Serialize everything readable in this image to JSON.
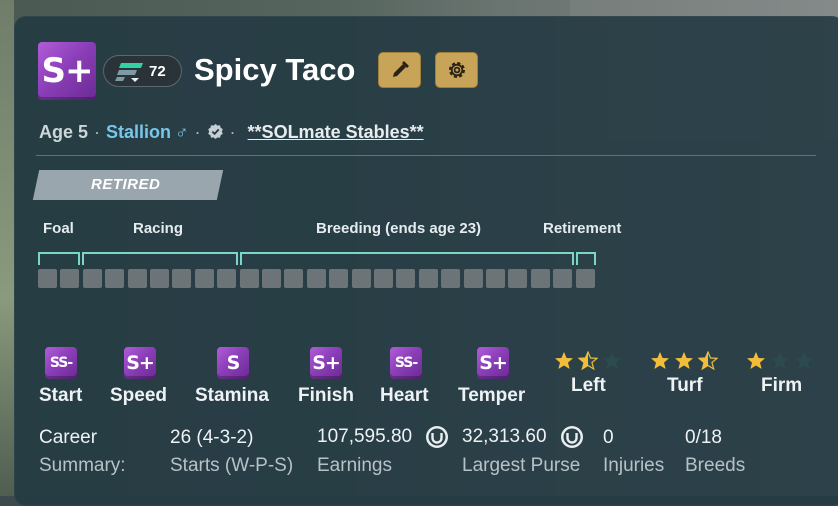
{
  "horse": {
    "name": "Spicy Taco",
    "grade": "S+",
    "rating": "72",
    "age": "Age 5",
    "gender": "Stallion",
    "gender_symbol": "♂",
    "stable": "**SOLmate Stables**",
    "status": "RETIRED"
  },
  "icons": {
    "edit": "pencil-icon",
    "settings": "gear-icon",
    "verified": "verified-badge-icon",
    "rating": "speed-lines-icon",
    "currency": "horseshoe-coin-icon"
  },
  "colors": {
    "accent_gold": "#c8a458",
    "grade_purple": "#8b3fb8",
    "timeline_teal": "#7ad6c5",
    "stallion_blue": "#78c6ea",
    "star_gold": "#f1bd3a"
  },
  "lifecycle": {
    "stages": [
      "Foal",
      "Racing",
      "Breeding (ends age 23)",
      "Retirement"
    ],
    "cell_count": 25
  },
  "stats": [
    {
      "label": "Start",
      "grade": "SS-"
    },
    {
      "label": "Speed",
      "grade": "S+"
    },
    {
      "label": "Stamina",
      "grade": "S"
    },
    {
      "label": "Finish",
      "grade": "S+"
    },
    {
      "label": "Heart",
      "grade": "SS-"
    },
    {
      "label": "Temper",
      "grade": "S+"
    }
  ],
  "preferences": [
    {
      "label": "Left",
      "stars": 1.5
    },
    {
      "label": "Turf",
      "stars": 2.5
    },
    {
      "label": "Firm",
      "stars": 1
    }
  ],
  "summary": {
    "label_line1": "Career",
    "label_line2": "Summary:",
    "starts_value": "26 (4-3-2)",
    "starts_label": "Starts (W-P-S)",
    "earnings_value": "107,595.80",
    "earnings_label": "Earnings",
    "purse_value": "32,313.60",
    "purse_label": "Largest Purse",
    "injuries_value": "0",
    "injuries_label": "Injuries",
    "breeds_value": "0/18",
    "breeds_label": "Breeds"
  }
}
